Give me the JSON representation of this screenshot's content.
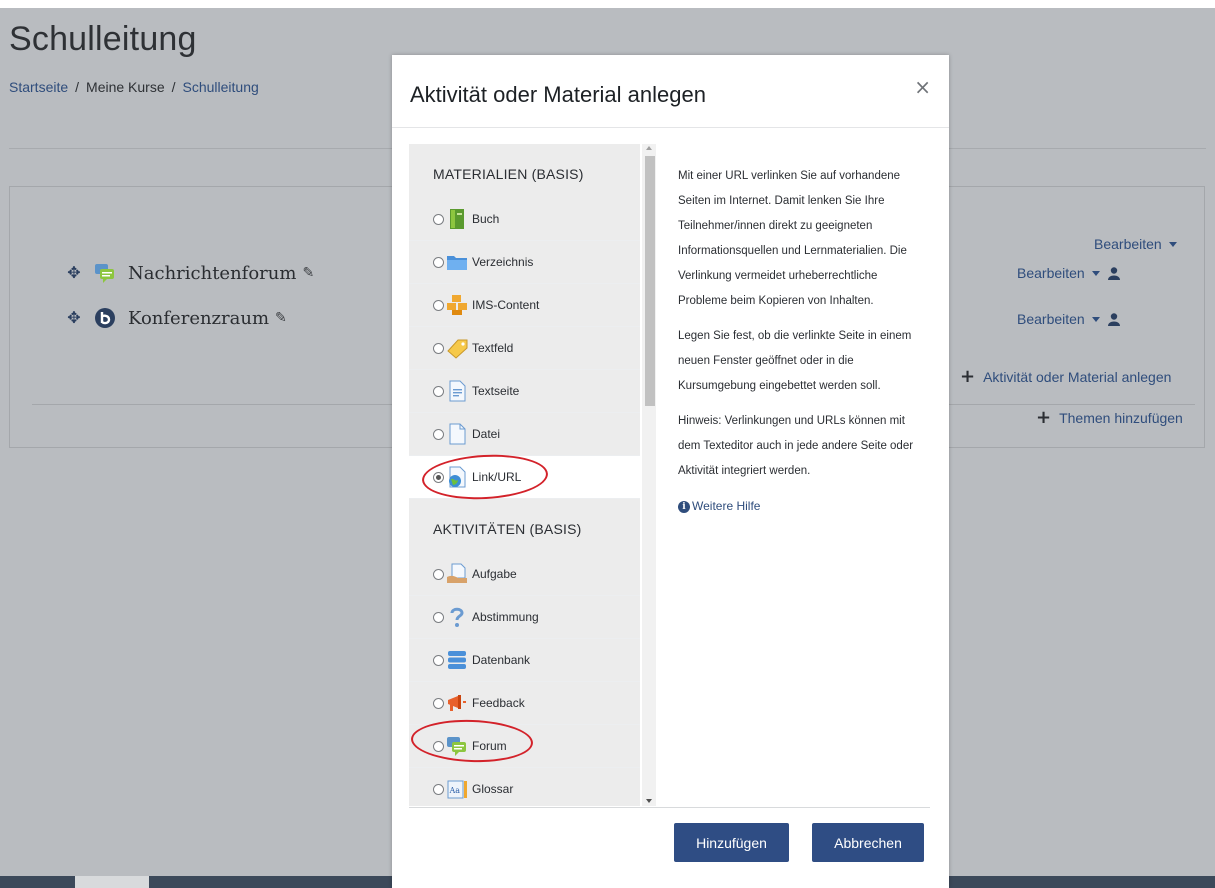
{
  "page": {
    "title": "Schulleitung",
    "breadcrumb": {
      "home": "Startseite",
      "courses": "Meine Kurse",
      "current": "Schulleitung",
      "sep": "/"
    }
  },
  "course": {
    "activities": [
      {
        "name": "Nachrichtenforum",
        "icon": "forum-icon"
      },
      {
        "name": "Konferenzraum",
        "icon": "bigbluebutton-icon"
      }
    ],
    "edit_label": "Bearbeiten",
    "add_activity": "Aktivität oder Material anlegen",
    "add_topics": "Themen hinzufügen"
  },
  "modal": {
    "title": "Aktivität oder Material anlegen",
    "close": "×",
    "sections": {
      "materials": "MATERIALIEN (BASIS)",
      "activities": "AKTIVITÄTEN (BASIS)"
    },
    "materials": [
      {
        "label": "Buch",
        "icon": "book-icon"
      },
      {
        "label": "Verzeichnis",
        "icon": "folder-icon"
      },
      {
        "label": "IMS-Content",
        "icon": "ims-content-icon"
      },
      {
        "label": "Textfeld",
        "icon": "label-icon"
      },
      {
        "label": "Textseite",
        "icon": "page-icon"
      },
      {
        "label": "Datei",
        "icon": "file-icon"
      },
      {
        "label": "Link/URL",
        "icon": "url-icon",
        "selected": true
      }
    ],
    "activities": [
      {
        "label": "Aufgabe",
        "icon": "assignment-icon"
      },
      {
        "label": "Abstimmung",
        "icon": "choice-icon"
      },
      {
        "label": "Datenbank",
        "icon": "database-icon"
      },
      {
        "label": "Feedback",
        "icon": "feedback-icon"
      },
      {
        "label": "Forum",
        "icon": "forum-icon"
      },
      {
        "label": "Glossar",
        "icon": "glossary-icon"
      }
    ],
    "description": {
      "p1": "Mit einer URL verlinken Sie auf vorhandene Seiten im Internet. Damit lenken Sie Ihre Teilnehmer/innen direkt zu geeigneten Informationsquellen und Lernmaterialien. Die Verlinkung vermeidet urheberrechtliche Probleme beim Kopieren von Inhalten.",
      "p2": "Legen Sie fest, ob die verlinkte Seite in einem neuen Fenster geöffnet oder in die Kursumgebung eingebettet werden soll.",
      "p3": "Hinweis: Verlinkungen und URLs können mit dem Texteditor auch in jede andere Seite oder Aktivität integriert werden.",
      "help": "Weitere Hilfe"
    },
    "buttons": {
      "add": "Hinzufügen",
      "cancel": "Abbrechen"
    }
  },
  "colors": {
    "link": "#2f4d7c",
    "button": "#2f4d84",
    "annotation": "#d3222a",
    "overlay": "#b9bcc0"
  }
}
